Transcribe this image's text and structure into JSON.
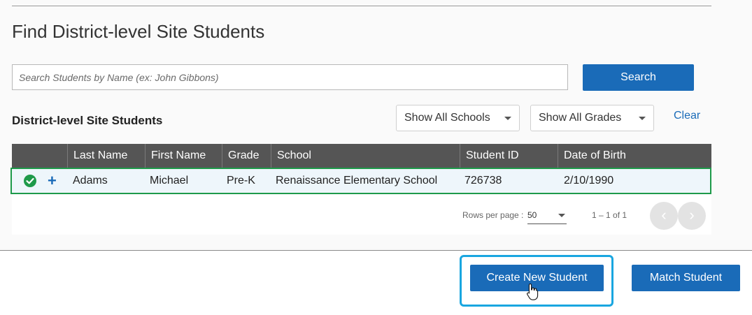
{
  "page": {
    "title": "Find District-level Site Students"
  },
  "search": {
    "placeholder": "Search Students by Name (ex: John Gibbons)",
    "value": "",
    "button_label": "Search"
  },
  "list": {
    "title": "District-level Site Students",
    "filters": {
      "schools": "Show All Schools",
      "grades": "Show All Grades",
      "clear_label": "Clear"
    }
  },
  "table": {
    "columns": [
      "Last Name",
      "First Name",
      "Grade",
      "School",
      "Student ID",
      "Date of Birth"
    ],
    "rows": [
      {
        "last_name": "Adams",
        "first_name": "Michael",
        "grade": "Pre-K",
        "school": "Renaissance Elementary School",
        "student_id": "726738",
        "dob": "2/10/1990",
        "status_icon": "check-circle-icon",
        "action_icon": "plus-icon"
      }
    ]
  },
  "pagination": {
    "rows_label": "Rows per page :",
    "rows_value": "50",
    "range": "1 – 1 of 1",
    "prev_icon": "chevron-left-icon",
    "next_icon": "chevron-right-icon"
  },
  "actions": {
    "create_label": "Create New Student",
    "match_label": "Match Student"
  },
  "colors": {
    "primary": "#1a6bb8",
    "header_bg": "#555555",
    "row_border": "#1e9a4a",
    "highlight": "#19a6e0"
  }
}
